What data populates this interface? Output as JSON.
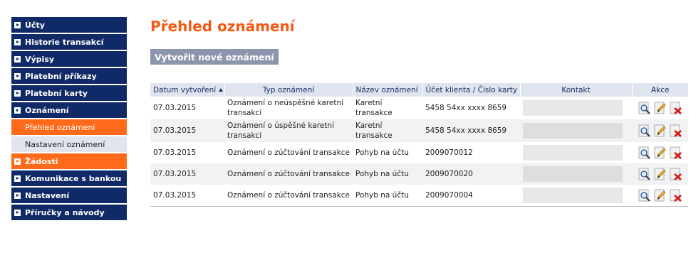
{
  "sidebar": {
    "items": [
      {
        "label": "Účty"
      },
      {
        "label": "Historie transakcí"
      },
      {
        "label": "Výpisy"
      },
      {
        "label": "Platební příkazy"
      },
      {
        "label": "Platební karty"
      },
      {
        "label": "Oznámení"
      },
      {
        "label": "Žádosti"
      },
      {
        "label": "Komunikace s bankou"
      },
      {
        "label": "Nastavení"
      },
      {
        "label": "Příručky a návody"
      }
    ],
    "subitems": [
      {
        "label": "Přehled oznámení"
      },
      {
        "label": "Nastavení oznámení"
      }
    ]
  },
  "main": {
    "title": "Přehled oznámení",
    "create_button": "Vytvořit nové oznámení",
    "columns": [
      "Datum vytvoření",
      "Typ oznámení",
      "Název oznámení",
      "Účet klienta / Číslo karty",
      "Kontakt",
      "Akce"
    ],
    "rows": [
      {
        "date": "07.03.2015",
        "type": "Oznámení o neúspěšné karetní transakci",
        "name": "Karetní transakce",
        "account": "5458 54xx xxxx 8659"
      },
      {
        "date": "07.03.2015",
        "type": "Oznámení o úspěšné karetní transakci",
        "name": "Karetní transakce",
        "account": "5458 54xx xxxx 8659"
      },
      {
        "date": "07.03.2015",
        "type": "Oznámení o zúčtování transakce",
        "name": "Pohyb na účtu",
        "account": "2009070012"
      },
      {
        "date": "07.03.2015",
        "type": "Oznámení o zúčtování transakce",
        "name": "Pohyb na účtu",
        "account": "2009070020"
      },
      {
        "date": "07.03.2015",
        "type": "Oznámení o zúčtování transakce",
        "name": "Pohyb na účtu",
        "account": "2009070004"
      }
    ],
    "action_icons": [
      "magnifier-icon",
      "pencil-icon",
      "delete-icon"
    ]
  },
  "colors": {
    "nav_bg": "#102a67",
    "accent": "#ff6a1a",
    "title": "#f05a14",
    "button_bg": "#8b95ab",
    "table_header_bg": "#dfe4ee"
  }
}
